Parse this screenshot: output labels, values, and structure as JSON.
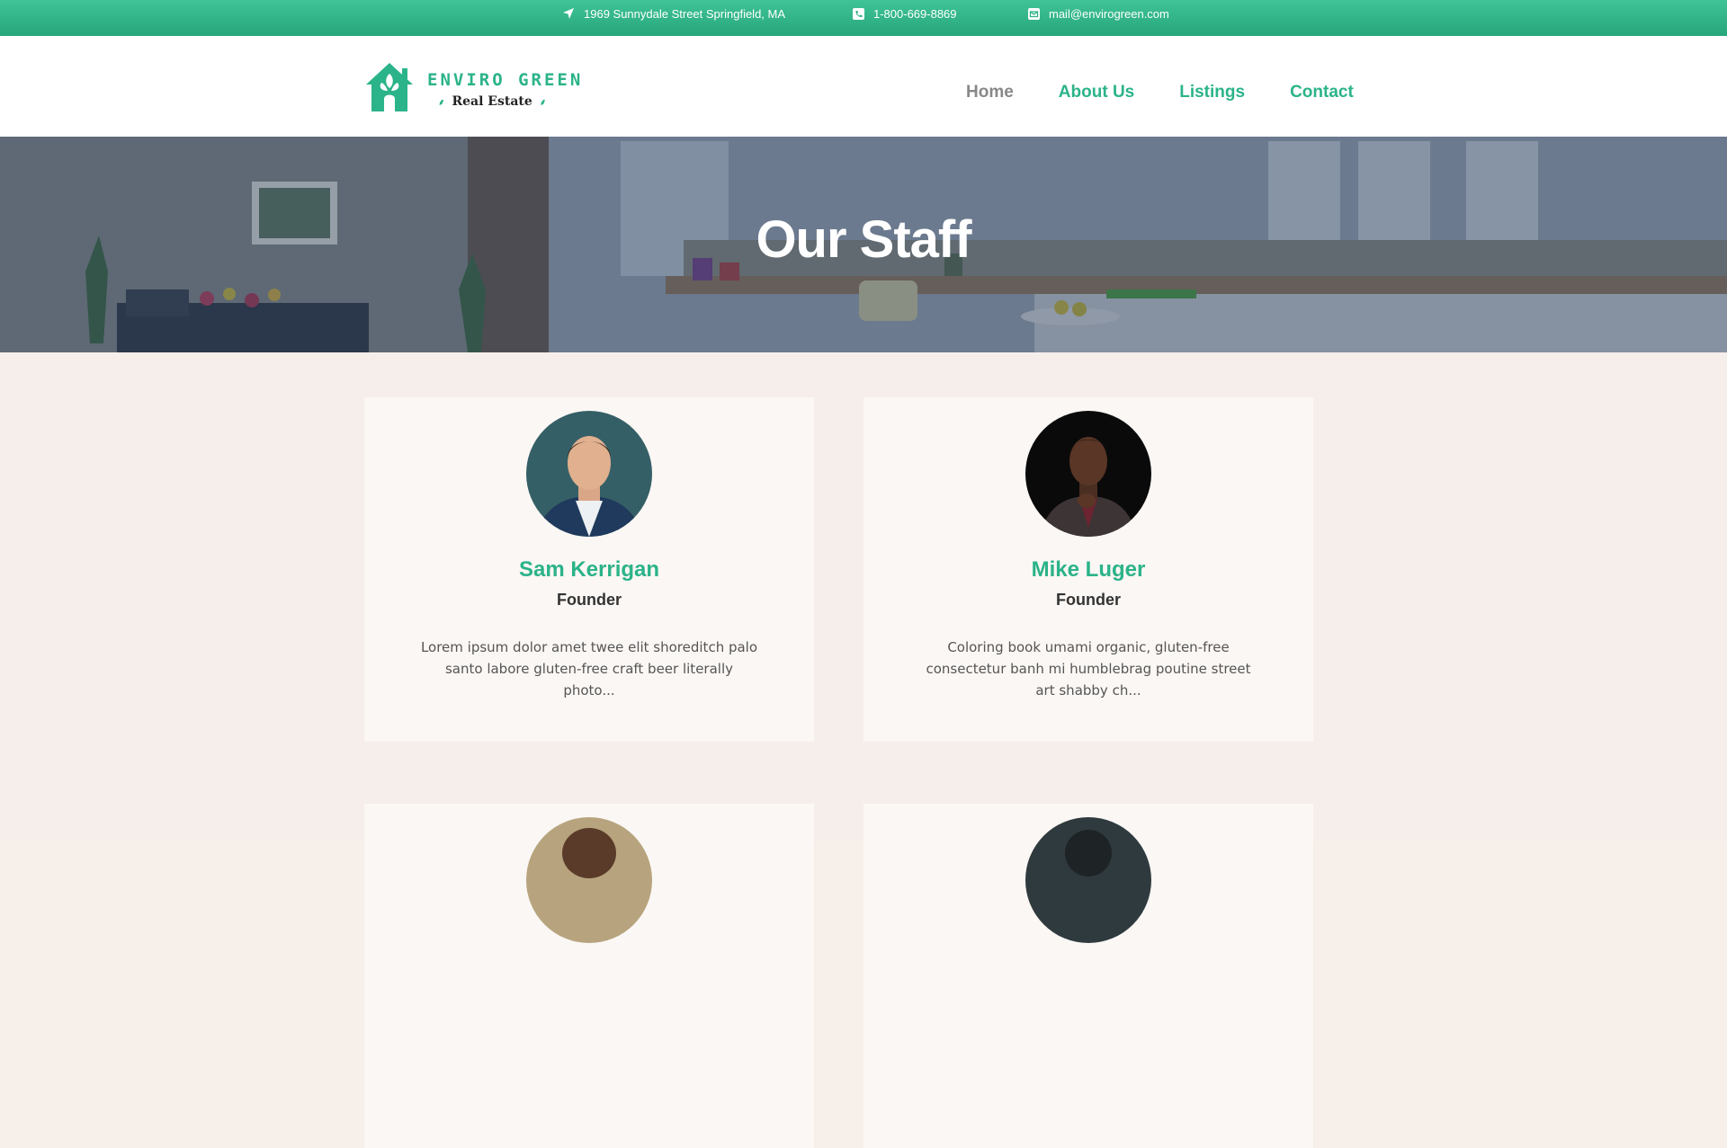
{
  "topbar": {
    "address": "1969 Sunnydale Street Springfield, MA",
    "phone": "1-800-669-8869",
    "email": "mail@envirogreen.com",
    "icons": {
      "address": "location-arrow-icon",
      "phone": "phone-square-icon",
      "email": "envelope-icon"
    }
  },
  "header": {
    "brand_name": "ENVIRO GREEN",
    "brand_sub": "Real Estate",
    "nav": [
      {
        "label": "Home",
        "active": true
      },
      {
        "label": "About Us",
        "active": false
      },
      {
        "label": "Listings",
        "active": false
      },
      {
        "label": "Contact",
        "active": false
      }
    ]
  },
  "hero": {
    "title": "Our Staff"
  },
  "staff": [
    {
      "name": "Sam Kerrigan",
      "role": "Founder",
      "bio": "Lorem ipsum dolor amet twee elit shoreditch palo santo labore gluten-free craft beer literally photo..."
    },
    {
      "name": "Mike Luger",
      "role": "Founder",
      "bio": "Coloring book umami organic, gluten-free consectetur banh mi humblebrag poutine street art shabby ch..."
    }
  ],
  "colors": {
    "accent": "#2bb389",
    "topbar": "#2fb386",
    "nav_active": "#888888",
    "page_bg": "#f6eeea"
  }
}
